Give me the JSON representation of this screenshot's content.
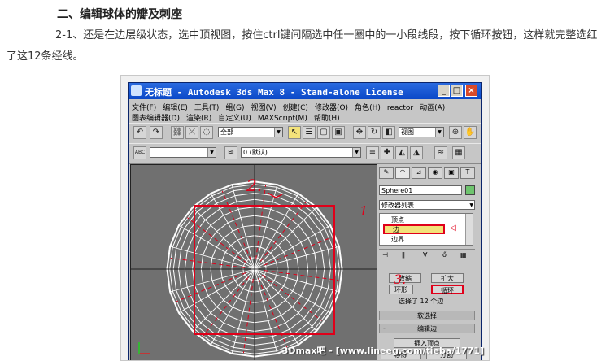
{
  "heading": "二、编辑球体的瓣及刺座",
  "paragraph": "2-1、还是在边层级状态，选中顶视图，按住ctrl键间隔选中任一圈中的一小段线段，按下循环按钮，这样就完整选红了这12条经线。",
  "app": {
    "title": "无标题 - Autodesk 3ds Max 8 - Stand-alone License",
    "window_buttons": [
      "_",
      "□",
      "×"
    ],
    "menu_row1": [
      "文件(F)",
      "编辑(E)",
      "工具(T)",
      "组(G)",
      "视图(V)",
      "创建(C)",
      "修改器(O)",
      "角色(H)",
      "reactor",
      "动画(A)"
    ],
    "menu_row2": [
      "图表编辑器(D)",
      "渲染(R)",
      "自定义(U)",
      "MAXScript(M)",
      "帮助(H)"
    ],
    "toolbar1": {
      "filter_value": "全部",
      "coord_value": "视图"
    },
    "toolbar2": {
      "layer_value": "0 (默认)",
      "abc_label": "ABC"
    }
  },
  "viewport": {
    "annotation_2": "2."
  },
  "command_panel": {
    "object_name": "Sphere01",
    "modifier_list": "修改器列表",
    "stack": [
      "顶点",
      "边",
      "边界"
    ],
    "annotation_1": "1",
    "annotation_3": "3.",
    "btn_shrink": "收缩",
    "btn_grow": "扩大",
    "btn_ring": "环形",
    "btn_loop": "循环",
    "selection_status": "选择了 12 个边",
    "rollout_soft": "软选择",
    "rollout_edit_edges": "编辑边",
    "btn_insert_vertex": "插入顶点",
    "btn_remove": "移除",
    "btn_split": "分割",
    "plus_sign": "+",
    "minus_sign": "-"
  },
  "watermark": "3Dmax吧 - [www.lineeg.com/tieba/1771]",
  "colors": {
    "title_bar": "#0a48c8",
    "selection_red": "#e0001a",
    "viewport_bg": "#707070",
    "wire": "#ffffff",
    "highlight": "#f3e27a"
  },
  "sphere": {
    "meridians": 12,
    "latitude_rings": 11
  }
}
